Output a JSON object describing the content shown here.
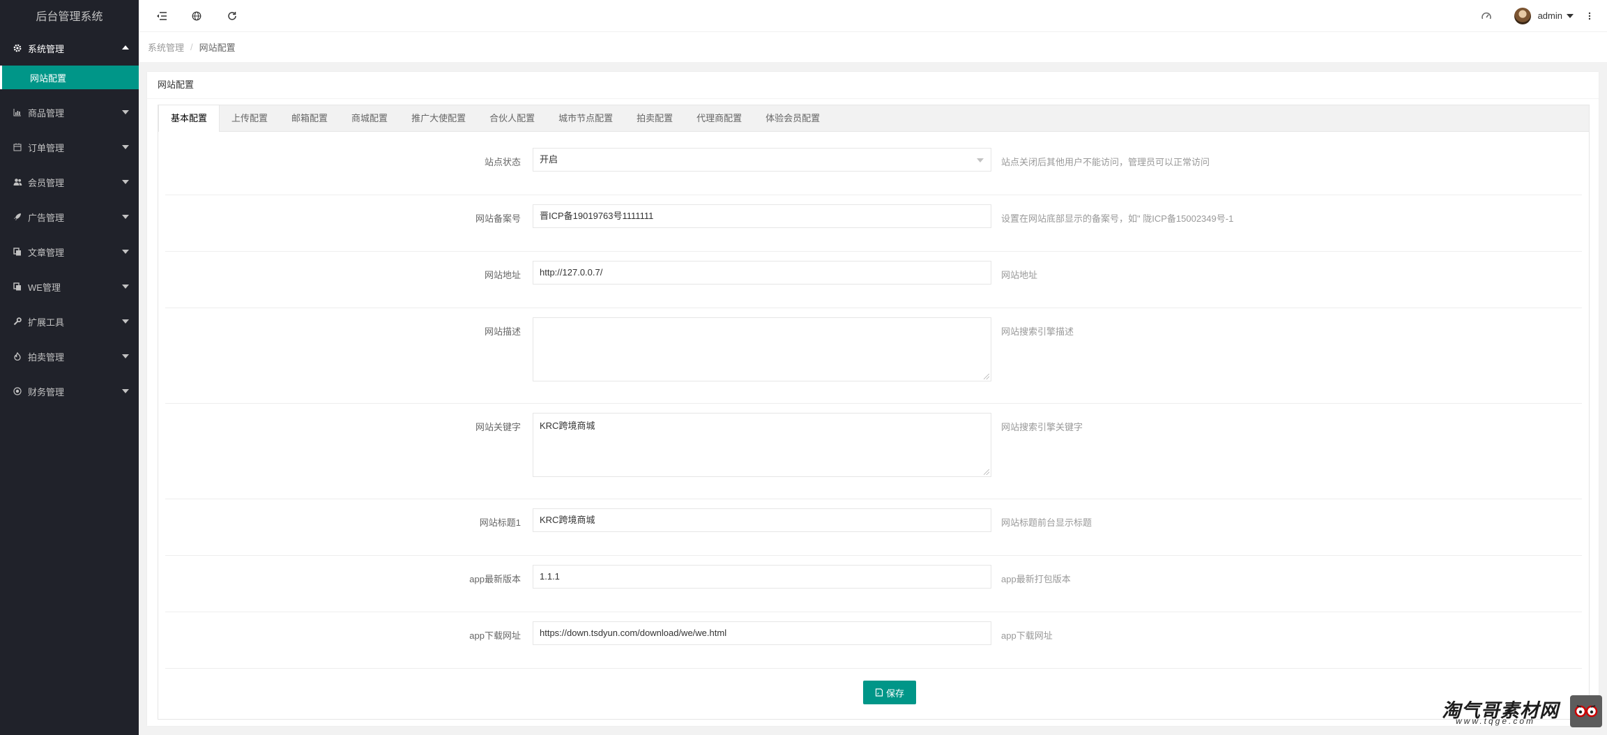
{
  "app": {
    "title": "后台管理系统"
  },
  "sidebar": {
    "items": [
      {
        "label": "系统管理",
        "icon": "gear-icon",
        "open": true
      },
      {
        "label": "商品管理",
        "icon": "bar-chart-icon"
      },
      {
        "label": "订单管理",
        "icon": "calendar-icon"
      },
      {
        "label": "会员管理",
        "icon": "users-icon"
      },
      {
        "label": "广告管理",
        "icon": "rocket-icon"
      },
      {
        "label": "文章管理",
        "icon": "copy-icon"
      },
      {
        "label": "WE管理",
        "icon": "copy-icon"
      },
      {
        "label": "扩展工具",
        "icon": "wrench-icon"
      },
      {
        "label": "拍卖管理",
        "icon": "fire-icon"
      },
      {
        "label": "财务管理",
        "icon": "target-icon"
      }
    ],
    "sub_items": [
      {
        "label": "网站配置",
        "active": true
      }
    ]
  },
  "header": {
    "buttons": [
      "shrink-menu-icon",
      "globe-icon",
      "refresh-icon"
    ],
    "right_icons": [
      "theme-icon",
      "fullscreen-icon",
      "more-icon"
    ],
    "user": {
      "name": "admin"
    }
  },
  "breadcrumb": {
    "parent": "系统管理",
    "sep": "/",
    "current": "网站配置"
  },
  "card": {
    "title": "网站配置"
  },
  "tabs": [
    {
      "label": "基本配置",
      "active": true
    },
    {
      "label": "上传配置"
    },
    {
      "label": "邮箱配置"
    },
    {
      "label": "商城配置"
    },
    {
      "label": "推广大使配置"
    },
    {
      "label": "合伙人配置"
    },
    {
      "label": "城市节点配置"
    },
    {
      "label": "拍卖配置"
    },
    {
      "label": "代理商配置"
    },
    {
      "label": "体验会员配置"
    }
  ],
  "form": {
    "site_status": {
      "label": "站点状态",
      "value": "开启",
      "hint": "站点关闭后其他用户不能访问，管理员可以正常访问"
    },
    "icp": {
      "label": "网站备案号",
      "value": "晋ICP备19019763号1111111",
      "hint": "设置在网站底部显示的备案号，如\" 陇ICP备15002349号-1"
    },
    "url": {
      "label": "网站地址",
      "value": "http://127.0.0.7/",
      "hint": "网站地址"
    },
    "description": {
      "label": "网站描述",
      "value": "",
      "hint": "网站搜索引擎描述"
    },
    "keywords": {
      "label": "网站关键字",
      "value": "KRC跨境商城",
      "hint": "网站搜索引擎关键字"
    },
    "title1": {
      "label": "网站标题1",
      "value": "KRC跨境商城",
      "hint": "网站标题前台显示标题"
    },
    "app_version": {
      "label": "app最新版本",
      "value": "1.1.1",
      "hint": "app最新打包版本"
    },
    "app_download": {
      "label": "app下载网址",
      "value": "https://down.tsdyun.com/download/we/we.html",
      "hint": "app下载网址"
    },
    "save_label": "保存"
  },
  "watermark": {
    "title": "淘气哥素材网",
    "url": "www.tqge.com"
  },
  "colors": {
    "sidebar_bg": "#20222a",
    "accent": "#009688"
  }
}
